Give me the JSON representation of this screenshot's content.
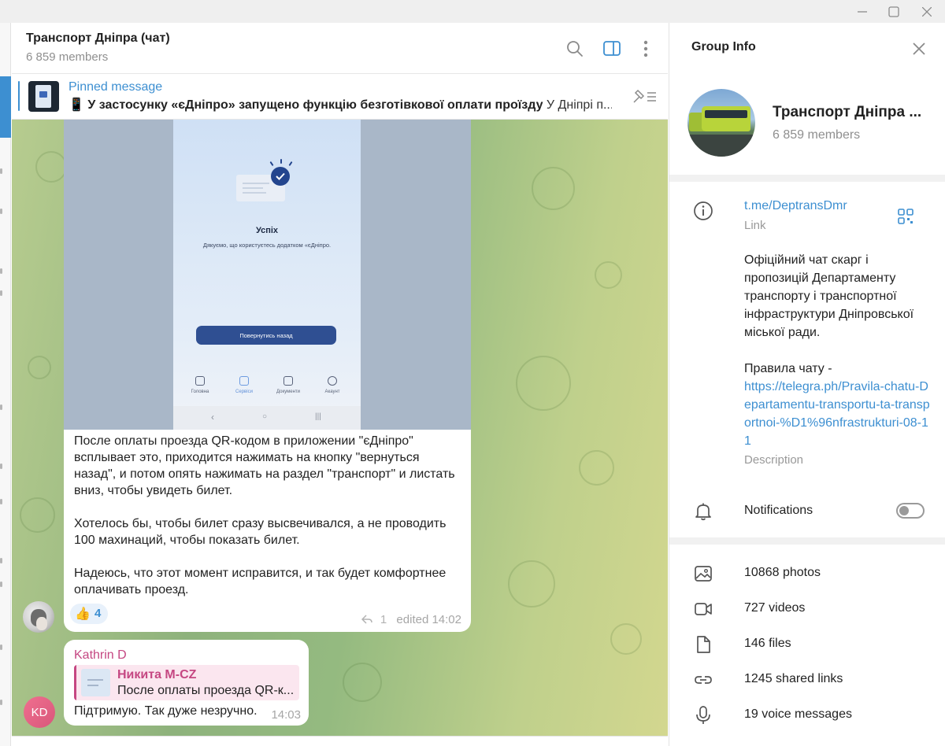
{
  "chat": {
    "title": "Транспорт Дніпра (чат)",
    "members": "6 859 members"
  },
  "pinned": {
    "label": "Pinned message",
    "emoji": "📱",
    "text_bold": "У застосунку «єДніпро» запущено функцію безготівкової оплати проїзду",
    "text_rest": "У Дніпрі п..."
  },
  "messages": {
    "first": {
      "screenshot": {
        "title": "Успіх",
        "subtitle": "Дякуємо, що користуєтесь додатком «єДніпро.",
        "button": "Повернутись назад",
        "tabs": [
          "Головна",
          "Сервіси",
          "Документи",
          "Акаунт"
        ]
      },
      "text": "После оплаты проезда QR-кодом в приложении \"єДніпро\" всплывает это, приходится нажимать на кнопку \"вернуться назад\", и потом опять нажимать на раздел \"транспорт\" и листать вниз, чтобы увидеть билет.\n\nХотелось бы, чтобы билет сразу высвечивался, а не проводить 100 махинаций, чтобы показать билет.\n\nНадеюсь, что этот момент исправится, и так будет комфортнее оплачивать проезд.",
      "reaction_emoji": "👍",
      "reaction_count": "4",
      "replies": "1",
      "edited": "edited 14:02"
    },
    "second": {
      "author": "Kathrin D",
      "reply_author": "Никита M-CZ",
      "reply_text": "После оплаты проезда QR-к...",
      "text": "Підтримую. Так дуже незручно.",
      "time": "14:03",
      "avatar_initials": "KD"
    }
  },
  "info": {
    "header": "Group Info",
    "name": "Транспорт Дніпра ...",
    "members": "6 859 members",
    "link": "t.me/DeptransDmr",
    "link_label": "Link",
    "description": "Офіційний чат скарг і пропозицій Департаменту транспорту і транспортної інфраструктури Дніпровської міської ради.",
    "rules": "Правила чату -",
    "rules_link": "https://telegra.ph/Pravila-chatu-Departamentu-transportu-ta-transportnoi-%D1%96nfrastrukturi-08-11",
    "description_label": "Description",
    "notifications_label": "Notifications",
    "notifications_on": false,
    "media": {
      "photos": "10868 photos",
      "videos": "727 videos",
      "files": "146 files",
      "links": "1245 shared links",
      "voice": "19 voice messages"
    }
  },
  "colors": {
    "accent": "#3d8fd1",
    "author_pink": "#c54782",
    "avatar_kd": "#e8657f"
  }
}
